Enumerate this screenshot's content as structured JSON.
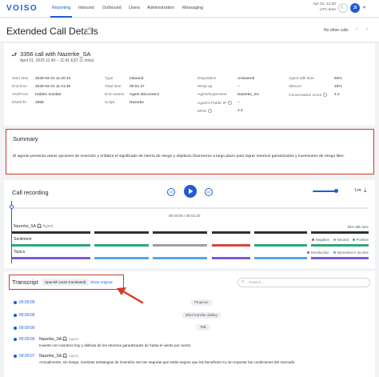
{
  "nav": {
    "logo": "VOISO",
    "items": [
      "Reporting",
      "Inbound",
      "Outbound",
      "Users",
      "Administration",
      "Messaging"
    ],
    "clock_date": "Apr 01, 12:30",
    "clock_zone": "UTC time",
    "avatar_initials": "JI"
  },
  "header": {
    "title": "Extended Call Details",
    "no_other_calls": "No other calls"
  },
  "call": {
    "title": "3356 call with Nazerke_SA",
    "subtitle": "April 01, 2025  11:40 – 11:41 EST (1 mins)",
    "details": [
      {
        "label": "Start time",
        "value": "2025-04-01  11:40:13"
      },
      {
        "label": "End time",
        "value": "2025-04-01  11:41:40"
      },
      {
        "label": "ANI/From",
        "value": "Hidden number"
      },
      {
        "label": "DNIS/To",
        "value": "3356"
      },
      {
        "label": "Type",
        "value": "Inbound"
      },
      {
        "label": "Total time",
        "value": "00:01:27"
      },
      {
        "label": "End reason",
        "value": "Agent disconnect"
      },
      {
        "label": "Script",
        "value": "Nazerke"
      },
      {
        "label": "Disposition",
        "value": "Answered"
      },
      {
        "label": "Wrap-up",
        "value": "–"
      },
      {
        "label": "Agent/Supervisor",
        "value": "Nazerke_SA"
      },
      {
        "label": "Agent's Public IP",
        "value": "–"
      },
      {
        "label": "MOS",
        "value": "4.4"
      },
      {
        "label": "Agent talk time",
        "value": "84%"
      },
      {
        "label": "Silence",
        "value": "15%"
      },
      {
        "label": "Conversation score",
        "value": "4.2"
      }
    ]
  },
  "summary": {
    "title": "Summary",
    "text": "El agente presenta varias opciones de inversión y enfatiza el significado de tolería de riesgo y objetivos financieros a largo plazo para lograr retornos garantizados y inversiones de riesgo libre."
  },
  "recording": {
    "title": "Call recording",
    "skip_back": "10",
    "skip_forward": "10",
    "speed": "1x",
    "timecode": "00:00:00 / 00:01:23",
    "agent_label": "Nazerke_SA",
    "agent_role": "Agent",
    "agent_talk": "84% talk time",
    "sentiment_label": "Sentiment",
    "sentiment_legend": [
      "Negative",
      "Neutral",
      "Positive"
    ],
    "topics_label": "Topics",
    "topics_legend": [
      "Introduction",
      "Interested in income"
    ],
    "colors": {
      "negative": "#d6453a",
      "neutral": "#9aa0a8",
      "positive": "#2aa876",
      "introduction": "#7b5cd6",
      "income": "#5aa3e8",
      "talk": "#2b2f36"
    }
  },
  "transcript": {
    "title": "Transcript",
    "language": "Spanish (auto-translated)",
    "show_original": "Show original",
    "search_placeholder": "Search...",
    "events": [
      {
        "time": "00:00:00",
        "label": "Pequeue"
      },
      {
        "time": "00:00:00",
        "label": "Blind transfer dialing"
      },
      {
        "time": "00:00:00",
        "label": "Talk"
      }
    ],
    "utterances": [
      {
        "time": "00:00:00",
        "speaker": "Nazerke_SA",
        "role": "Agent",
        "text": "Invierte con nosotros hoy y disfruta de los retornos garantizados de hasta el veinte por ciento."
      },
      {
        "time": "00:00:07",
        "speaker": "Nazerke_SA",
        "role": "Agent",
        "text": "Annualmente, sin riesgo, nuestras estrategias de inversión son tan seguras que estás seguro que los beneficios Cy sin importar las condiciones del mercado."
      }
    ]
  }
}
